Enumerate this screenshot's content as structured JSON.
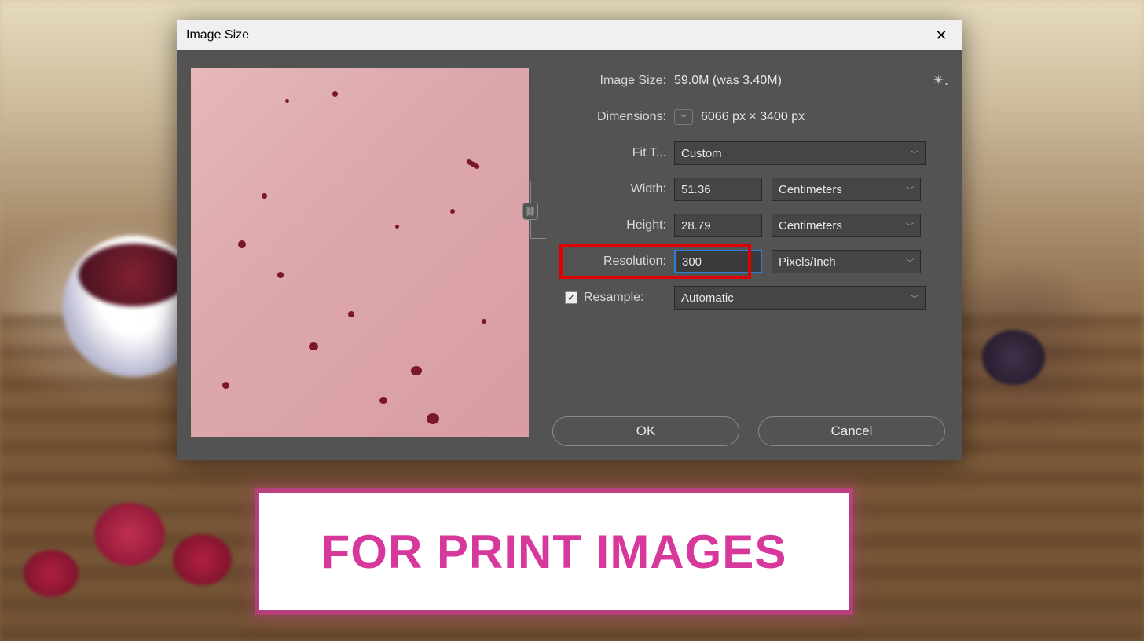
{
  "dialog": {
    "title": "Image Size",
    "imageSize": {
      "label": "Image Size:",
      "value": "59.0M (was 3.40M)"
    },
    "dimensions": {
      "label": "Dimensions:",
      "value": "6066 px  ×  3400 px"
    },
    "fitTo": {
      "label": "Fit T...",
      "value": "Custom"
    },
    "width": {
      "label": "Width:",
      "value": "51.36",
      "unit": "Centimeters"
    },
    "height": {
      "label": "Height:",
      "value": "28.79",
      "unit": "Centimeters"
    },
    "resolution": {
      "label": "Resolution:",
      "value": "300",
      "unit": "Pixels/Inch"
    },
    "resample": {
      "label": "Resample:",
      "checked": true,
      "value": "Automatic"
    },
    "buttons": {
      "ok": "OK",
      "cancel": "Cancel"
    }
  },
  "caption": "FOR PRINT IMAGES"
}
